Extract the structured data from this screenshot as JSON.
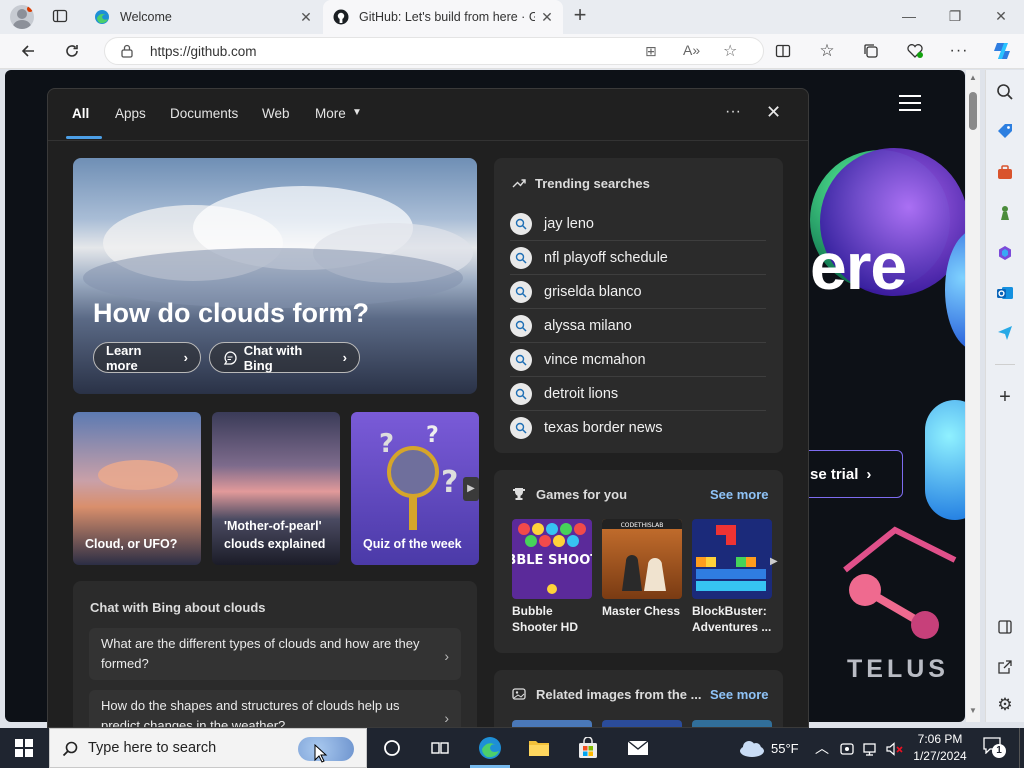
{
  "browser": {
    "tabs": [
      {
        "title": "Welcome"
      },
      {
        "title": "GitHub: Let's build from here · Gi"
      }
    ],
    "address": "https://github.com",
    "new_tab_label": "+"
  },
  "flyout": {
    "tabs": [
      "All",
      "Apps",
      "Documents",
      "Web",
      "More"
    ],
    "active_tab": "All",
    "more_menu": "···",
    "hero": {
      "title": "How do clouds form?",
      "learn_more": "Learn more",
      "chat_with_bing": "Chat with Bing"
    },
    "thumbnails": [
      {
        "caption": "Cloud, or UFO?"
      },
      {
        "caption": "'Mother-of-pearl' clouds explained"
      },
      {
        "caption": "Quiz of the week"
      }
    ],
    "chat": {
      "heading": "Chat with Bing about clouds",
      "questions": [
        "What are the different types of clouds and how are they formed?",
        "How do the shapes and structures of clouds help us predict changes in the weather?"
      ]
    },
    "trending": {
      "heading": "Trending searches",
      "items": [
        "jay leno",
        "nfl playoff schedule",
        "griselda blanco",
        "alyssa milano",
        "vince mcmahon",
        "detroit lions",
        "texas border news"
      ]
    },
    "games": {
      "heading": "Games for you",
      "see_more": "See more",
      "items": [
        {
          "name": "Bubble Shooter HD",
          "art_text": "BUBBLE SHOOTER"
        },
        {
          "name": "Master Chess",
          "art_text": "CODETHISLAB"
        },
        {
          "name": "BlockBuster: Adventures ..."
        }
      ]
    },
    "related": {
      "heading": "Related images from the ...",
      "see_more": "See more"
    }
  },
  "page_bg": {
    "hero_text": "ere",
    "trial_button": "se trial",
    "sponsor": "TELUS"
  },
  "taskbar": {
    "search_placeholder": "Type here to search",
    "weather": "55°F",
    "time": "7:06 PM",
    "date": "1/27/2024",
    "notification_count": "1"
  },
  "colors": {
    "accent": "#4c9fe6",
    "flyout_bg": "#202020",
    "card_bg": "#2b2b2b",
    "see_more": "#8fc3f7"
  }
}
